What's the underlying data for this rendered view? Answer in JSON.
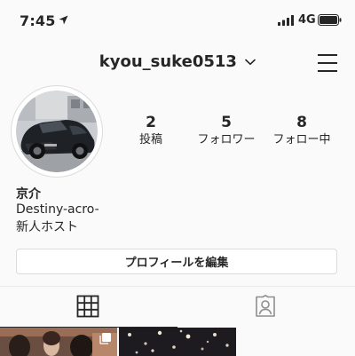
{
  "status": {
    "time": "7:45",
    "network": "4G"
  },
  "header": {
    "username": "kyou_suke0513"
  },
  "profile": {
    "stats": [
      {
        "value": "2",
        "label": "投稿"
      },
      {
        "value": "5",
        "label": "フォロワー"
      },
      {
        "value": "8",
        "label": "フォロー中"
      }
    ],
    "name": "京介",
    "bio": [
      "Destiny-acro-",
      "新人ホスト"
    ],
    "edit_label": "プロフィールを編集"
  },
  "tabs": [
    {
      "icon": "grid-icon",
      "active": true
    },
    {
      "icon": "tagged-icon",
      "active": false
    }
  ],
  "colors": {
    "background": "#fafafa",
    "text": "#262626",
    "border": "#dbdbdb"
  }
}
